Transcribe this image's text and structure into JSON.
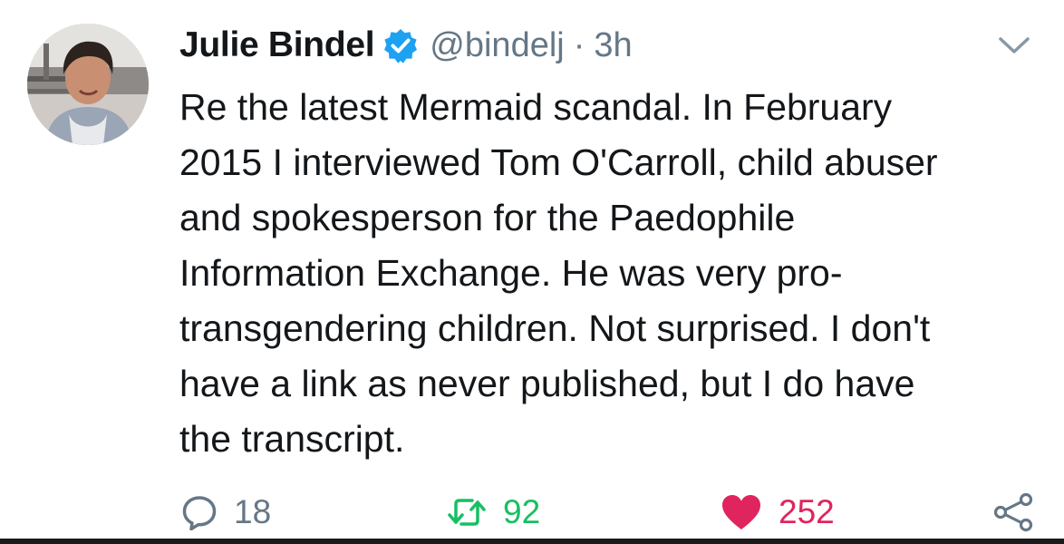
{
  "tweet": {
    "author_name": "Julie Bindel",
    "handle": "@bindelj",
    "separator": "·",
    "time": "3h",
    "text": "Re the latest Mermaid scandal. In February\n2015 I interviewed Tom O'Carroll, child abuser\nand spokesperson for the Paedophile\nInformation Exchange. He was very pro-\ntransgendering children. Not surprised. I don't\nhave a link as never published, but I do have\nthe transcript."
  },
  "actions": {
    "reply_count": "18",
    "retweet_count": "92",
    "like_count": "252"
  },
  "icons": {
    "verified": "verified-badge-icon",
    "caret": "chevron-down-icon",
    "reply": "reply-bubble-icon",
    "retweet": "retweet-icon",
    "like": "heart-icon",
    "share": "share-icon"
  },
  "colors": {
    "text": "#14171a",
    "secondary": "#657786",
    "verified": "#1da1f2",
    "retweet": "#17bf63",
    "like": "#e0245e"
  }
}
